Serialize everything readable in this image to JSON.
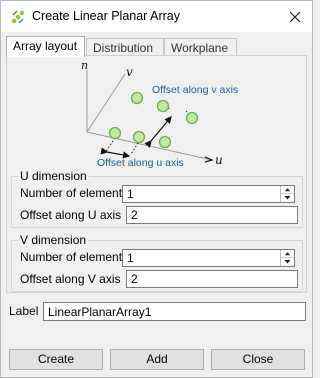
{
  "window": {
    "title": "Create Linear Planar Array"
  },
  "tabs": [
    {
      "label": "Array layout"
    },
    {
      "label": "Distribution"
    },
    {
      "label": "Workplane"
    }
  ],
  "diagram": {
    "axis_n": "n",
    "axis_v": "v",
    "axis_u": "u",
    "offset_v_label": "Offset along v axis",
    "offset_u_label": "Offset along u axis",
    "point_color": "#c8e6a0",
    "point_stroke": "#6ab04c",
    "caption_color": "#1f5b94"
  },
  "u_dimension": {
    "title": "U dimension",
    "elements_label": "Number of elements",
    "elements_value": "1",
    "offset_label": "Offset along U axis",
    "offset_value": "2"
  },
  "v_dimension": {
    "title": "V dimension",
    "elements_label": "Number of elements",
    "elements_value": "1",
    "offset_label": "Offset along V axis",
    "offset_value": "2"
  },
  "label_field": {
    "caption": "Label",
    "value": "LinearPlanarArray1"
  },
  "buttons": {
    "create": "Create",
    "add": "Add",
    "close": "Close"
  },
  "icons": {
    "app": "array-icon",
    "close": "close-icon"
  }
}
